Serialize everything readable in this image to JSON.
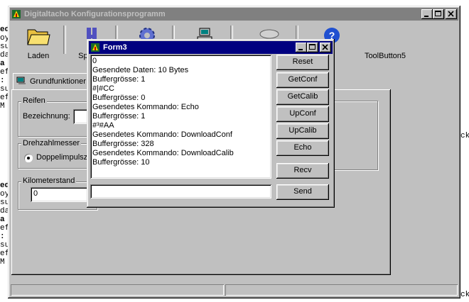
{
  "background_code": {
    "group1": [
      {
        "text": "ed",
        "bold": true
      },
      {
        "text": "oy",
        "bold": false
      },
      {
        "text": "su",
        "bold": false
      },
      {
        "text": "da",
        "bold": false
      },
      {
        "text": "a",
        "bold": true
      },
      {
        "text": "ef",
        "bold": false
      },
      {
        "text": ":",
        "bold": true
      },
      {
        "text": "su",
        "bold": false
      },
      {
        "text": "ef",
        "bold": false
      },
      {
        "text": "M",
        "bold": false
      }
    ],
    "group2": [
      {
        "text": "ed",
        "bold": true
      },
      {
        "text": "oy",
        "bold": false
      },
      {
        "text": "su",
        "bold": false
      },
      {
        "text": "da",
        "bold": false
      },
      {
        "text": "a",
        "bold": true
      },
      {
        "text": "ef",
        "bold": false
      },
      {
        "text": ":",
        "bold": true
      },
      {
        "text": "su",
        "bold": false
      },
      {
        "text": "ef",
        "bold": false
      },
      {
        "text": "M",
        "bold": false
      }
    ],
    "right_fragment_1": "ck",
    "right_fragment_2": "ck"
  },
  "main_window": {
    "title": "Digitaltacho Konfigurationsprogramm",
    "toolbar": [
      {
        "label": "Laden",
        "icon": "folder-icon"
      },
      {
        "label": "Speich",
        "icon": "save-icon"
      },
      {
        "label": "",
        "icon": "gear-icon"
      },
      {
        "label": "",
        "icon": "network-icon"
      },
      {
        "label": "",
        "icon": "cloud-icon"
      },
      {
        "label": "",
        "icon": "help-icon"
      },
      {
        "label": "ToolButton5",
        "icon": ""
      }
    ],
    "tab_label": "Grundfunktioner",
    "reifen": {
      "group_label": "Reifen",
      "bezeichnung_label": "Bezeichnung:",
      "bezeichnung_value": ""
    },
    "drehzahlmesser": {
      "group_label": "Drehzahlmesser",
      "radio_label": "Doppelimpulszä"
    },
    "kilometerstand": {
      "group_label": "Kilometerstand",
      "value": "0"
    }
  },
  "form3": {
    "title": "Form3",
    "memo_lines": [
      "0",
      "Gesendete Daten: 10 Bytes",
      "Buffergrösse: 1",
      "#|#CC",
      "Buffergrösse: 0",
      "Gesendetes Kommando: Echo",
      "Buffergrösse: 1",
      "#³#AA",
      "Gesendetes Kommando: DownloadConf",
      "Buffergrösse: 328",
      "Gesendetes Kommando: DownloadCalib",
      "Buffergrösse: 10"
    ],
    "buttons": [
      "Reset",
      "GetConf",
      "GetCalib",
      "UpConf",
      "UpCalib",
      "Echo"
    ],
    "recv_label": "Recv",
    "send_label": "Send",
    "send_input_value": ""
  },
  "colors": {
    "face": "#c0c0c0",
    "active_title": "#000080",
    "inactive_title": "#808080"
  }
}
